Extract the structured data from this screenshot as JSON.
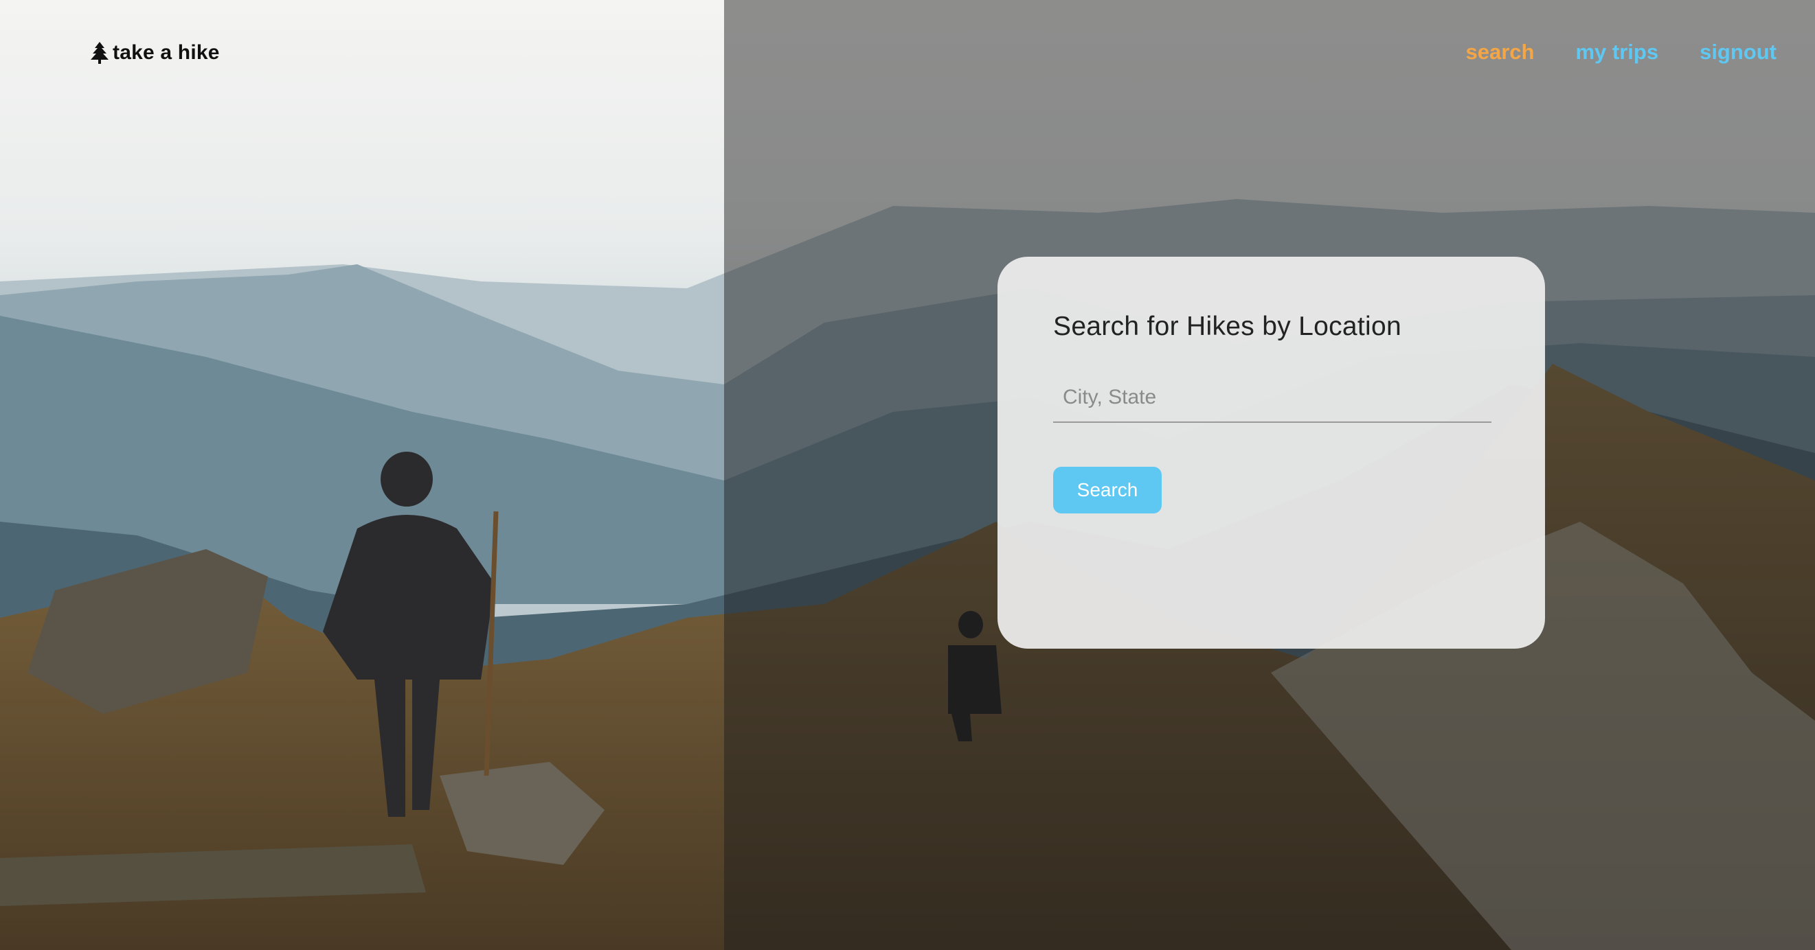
{
  "brand": {
    "name": "take a hike",
    "icon": "tree-icon"
  },
  "nav": {
    "items": [
      {
        "label": "search",
        "color": "#f4a646",
        "active": true
      },
      {
        "label": "my trips",
        "color": "#5ec8f2"
      },
      {
        "label": "signout",
        "color": "#5ec8f2"
      }
    ]
  },
  "search_card": {
    "title": "Search for Hikes by Location",
    "input": {
      "value": "",
      "placeholder": "City, State"
    },
    "button_label": "Search",
    "button_color": "#5ec8f2"
  }
}
